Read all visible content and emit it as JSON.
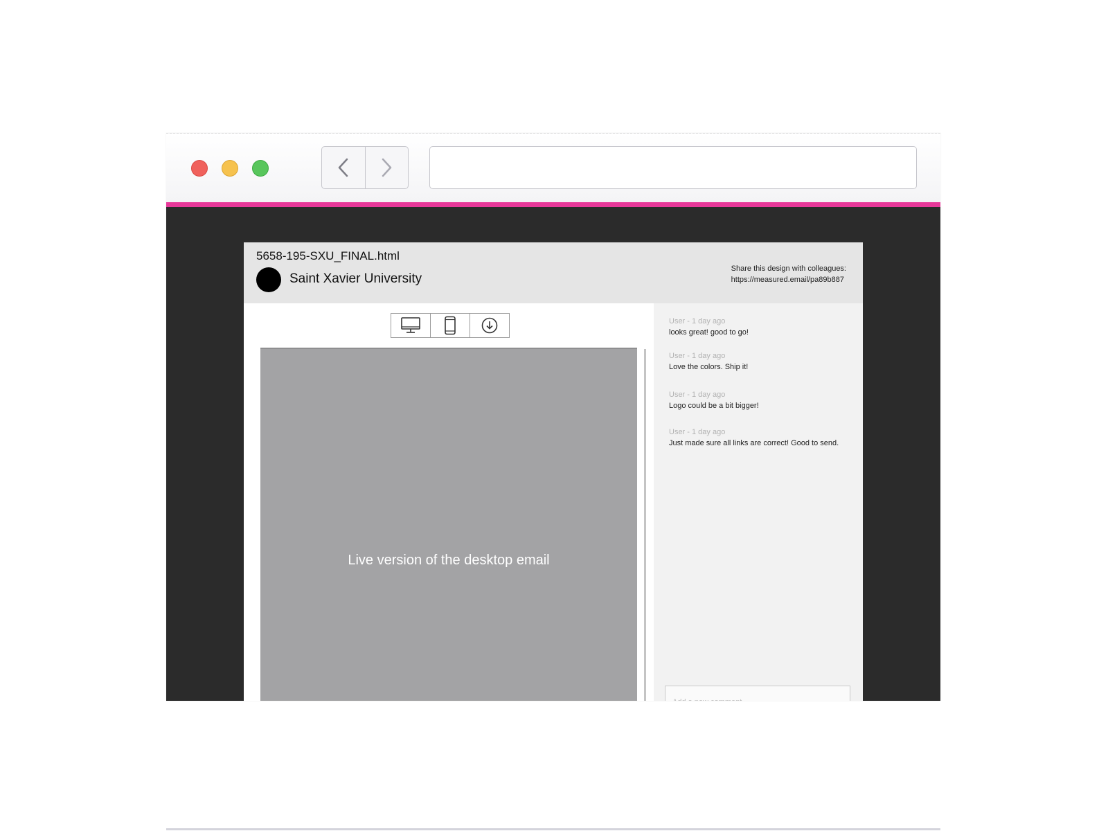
{
  "browser": {
    "address_bar_value": "",
    "colors": {
      "accent": "#e8389a",
      "close": "#f0615c",
      "minimize": "#f6c24e",
      "maximize": "#58c65c"
    },
    "icons": {
      "back": "chevron-left-icon",
      "forward": "chevron-right-icon"
    }
  },
  "header": {
    "file_name": "5658-195-SXU_FINAL.html",
    "brand_name": "Saint Xavier University",
    "share_label": "Share this design with colleagues:",
    "share_url": "https://measured.email/pa89b887"
  },
  "toolbar": {
    "icons": [
      "desktop-icon",
      "mobile-icon",
      "download-icon"
    ]
  },
  "preview": {
    "label": "Live version of the desktop email"
  },
  "comments": {
    "items": [
      {
        "meta": "User - 1 day ago",
        "text": "looks great! good to go!"
      },
      {
        "meta": "User - 1 day ago",
        "text": "Love the colors. Ship it!"
      },
      {
        "meta": "User - 1 day ago",
        "text": "Logo could be a bit bigger!"
      },
      {
        "meta": "User - 1 day ago",
        "text": "Just made sure all links are correct! Good to send."
      }
    ],
    "input_placeholder": "Add a new comment"
  }
}
